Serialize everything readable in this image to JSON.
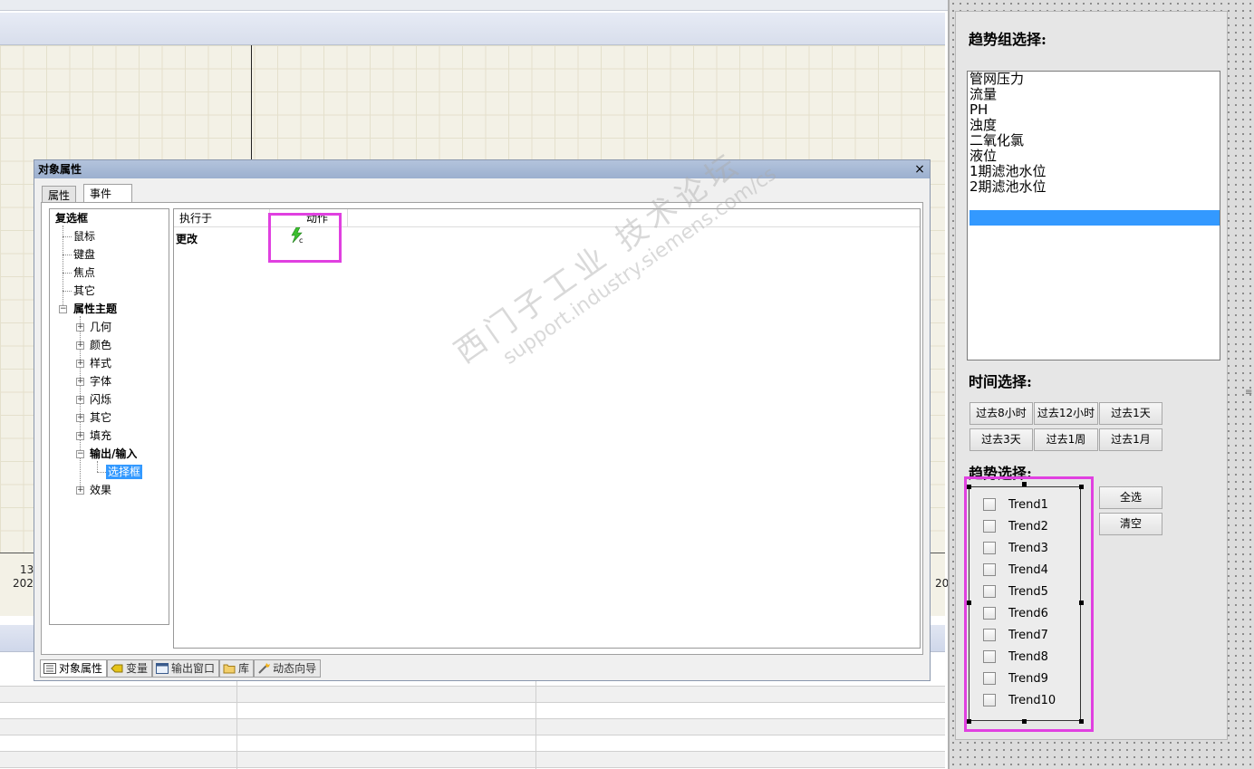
{
  "editor": {
    "axis_labels_left": [
      "13",
      "202"
    ],
    "axis_label_right": "20"
  },
  "dialog": {
    "title": "对象属性",
    "close_glyph": "×",
    "tabs": [
      {
        "label": "属性",
        "active": false
      },
      {
        "label": "事件",
        "active": true
      }
    ],
    "tree": {
      "root": "复选框",
      "children": [
        "鼠标",
        "键盘",
        "焦点",
        "其它"
      ],
      "property_topics": {
        "label": "属性主题",
        "items": [
          "几何",
          "颜色",
          "样式",
          "字体",
          "闪烁",
          "其它",
          "填充",
          "输出/输入",
          "效果"
        ],
        "io_child": "选择框"
      }
    },
    "event_table": {
      "columns": [
        "执行于",
        "动作"
      ],
      "rows": [
        {
          "trigger": "更改",
          "action_icon": "c-action-lightning-icon",
          "action_suffix": "c"
        }
      ]
    },
    "bottom_tabs": [
      {
        "label": "对象属性",
        "icon": "properties-icon",
        "active": true
      },
      {
        "label": "变量",
        "icon": "tag-icon",
        "active": false
      },
      {
        "label": "输出窗口",
        "icon": "output-window-icon",
        "active": false
      },
      {
        "label": "库",
        "icon": "folder-icon",
        "active": false
      },
      {
        "label": "动态向导",
        "icon": "wizard-icon",
        "active": false
      }
    ]
  },
  "right_panel": {
    "group_title": "趋势组选择:",
    "group_items": [
      "管网压力",
      "流量",
      "PH",
      "浊度",
      "二氧化氯",
      "液位",
      "1期滤池水位",
      "2期滤池水位",
      "",
      ""
    ],
    "group_selected_index": 9,
    "time_title": "时间选择:",
    "time_buttons": [
      "过去8小时",
      "过去12小时",
      "过去1天",
      "过去3天",
      "过去1周",
      "过去1月"
    ],
    "trend_title": "趋势选择:",
    "trends": [
      "Trend1",
      "Trend2",
      "Trend3",
      "Trend4",
      "Trend5",
      "Trend6",
      "Trend7",
      "Trend8",
      "Trend9",
      "Trend10"
    ],
    "select_all_label": "全选",
    "clear_label": "清空",
    "scroll_glyph": "≡"
  },
  "watermark": {
    "text_cn": "西门子工业 技术论坛",
    "text_url": "support.industry.siemens.com/cs"
  },
  "colors": {
    "highlight_frame": "#e040e0",
    "selection_blue": "#3399ff"
  }
}
